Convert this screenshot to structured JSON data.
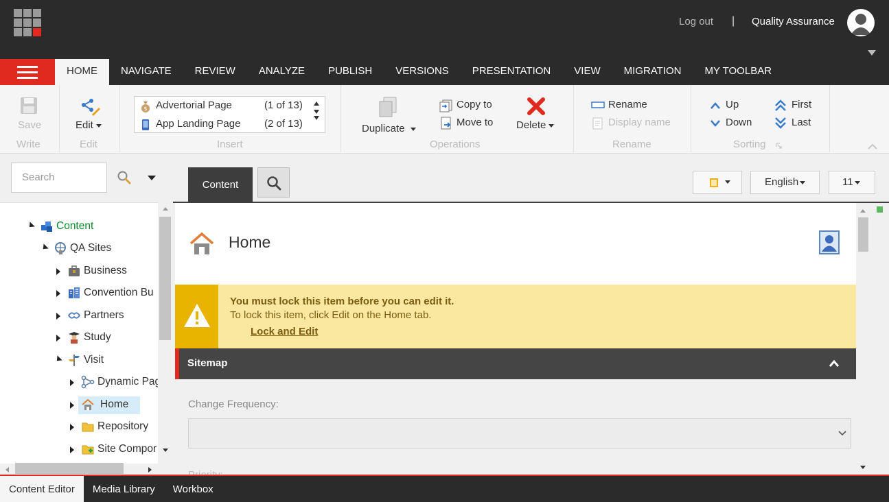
{
  "header": {
    "logout_label": "Log out",
    "separator": "|",
    "user_name": "Quality Assurance"
  },
  "ribbon_tabs": [
    "HOME",
    "NAVIGATE",
    "REVIEW",
    "ANALYZE",
    "PUBLISH",
    "VERSIONS",
    "PRESENTATION",
    "VIEW",
    "MIGRATION",
    "MY TOOLBAR"
  ],
  "ribbon": {
    "write": {
      "save_label": "Save",
      "group": "Write"
    },
    "edit": {
      "edit_label": "Edit",
      "group": "Edit"
    },
    "insert": {
      "group": "Insert",
      "items": [
        {
          "name": "Advertorial Page",
          "count": "(1 of 13)"
        },
        {
          "name": "App Landing Page",
          "count": "(2 of 13)"
        }
      ]
    },
    "operations": {
      "group": "Operations",
      "duplicate_label": "Duplicate",
      "copy_label": "Copy to",
      "move_label": "Move to",
      "delete_label": "Delete"
    },
    "rename": {
      "group": "Rename",
      "rename_label": "Rename",
      "display_name_label": "Display name"
    },
    "sorting": {
      "group": "Sorting",
      "up_label": "Up",
      "down_label": "Down",
      "first_label": "First",
      "last_label": "Last"
    }
  },
  "search": {
    "placeholder": "Search"
  },
  "tree": {
    "nodes": [
      {
        "label": "Content",
        "icon": "content-icon"
      },
      {
        "label": "QA Sites",
        "icon": "sites-icon"
      },
      {
        "label": "Business",
        "icon": "briefcase-icon"
      },
      {
        "label": "Convention Bu",
        "icon": "building-icon"
      },
      {
        "label": "Partners",
        "icon": "partners-icon"
      },
      {
        "label": "Study",
        "icon": "graduate-icon"
      },
      {
        "label": "Visit",
        "icon": "signpost-icon"
      },
      {
        "label": "Dynamic Pag",
        "icon": "dynamic-icon"
      },
      {
        "label": "Home",
        "icon": "home-icon"
      },
      {
        "label": "Repository",
        "icon": "folder-icon"
      },
      {
        "label": "Site Compor",
        "icon": "folder-plus-icon"
      }
    ]
  },
  "content": {
    "tab_label": "Content",
    "language": "English",
    "version": "11",
    "item_title": "Home",
    "warning": {
      "title": "You must lock this item before you can edit it.",
      "text": "To lock this item, click Edit on the Home tab.",
      "link": "Lock and Edit"
    },
    "section_title": "Sitemap",
    "field_change_frequency": "Change Frequency:",
    "field_priority": "Priority:"
  },
  "bottom_tabs": [
    "Content Editor",
    "Media Library",
    "Workbox"
  ],
  "colors": {
    "accent": "#e02a1f",
    "dark": "#2b2b2b",
    "warning_bg": "#fbe8a0",
    "warning_strip": "#e8b400"
  }
}
